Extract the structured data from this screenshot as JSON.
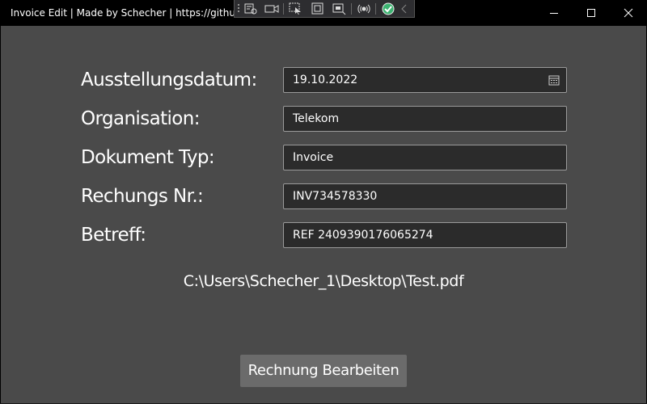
{
  "window": {
    "title": "Invoice Edit | Made by Schecher | https://github.com/Schecher",
    "icons": [
      "minimize-icon",
      "maximize-icon",
      "close-icon"
    ]
  },
  "devtools": {
    "icons": [
      "live-visual-tree-icon",
      "video-icon",
      "select-element-icon",
      "display-layout-adorners-icon",
      "track-focus-icon",
      "hot-reload-icon",
      "status-check-icon",
      "collapse-chevron-icon"
    ]
  },
  "form": {
    "fields": [
      {
        "label": "Ausstellungsdatum:",
        "value": "19.10.2022"
      },
      {
        "label": "Organisation:",
        "value": "Telekom"
      },
      {
        "label": "Dokument Typ:",
        "value": "Invoice"
      },
      {
        "label": "Rechungs Nr.:",
        "value": "INV734578330"
      },
      {
        "label": "Betreff:",
        "value": "REF 2409390176065274"
      }
    ],
    "file_path": "C:\\Users\\Schecher_1\\Desktop\\Test.pdf",
    "submit_label": "Rechnung Bearbeiten"
  },
  "colors": {
    "background": "#4a4a4a",
    "titlebar": "#000000",
    "field_background": "#2b2b2b",
    "button_background": "#6b6b6b",
    "status_ok": "#3cb371"
  }
}
